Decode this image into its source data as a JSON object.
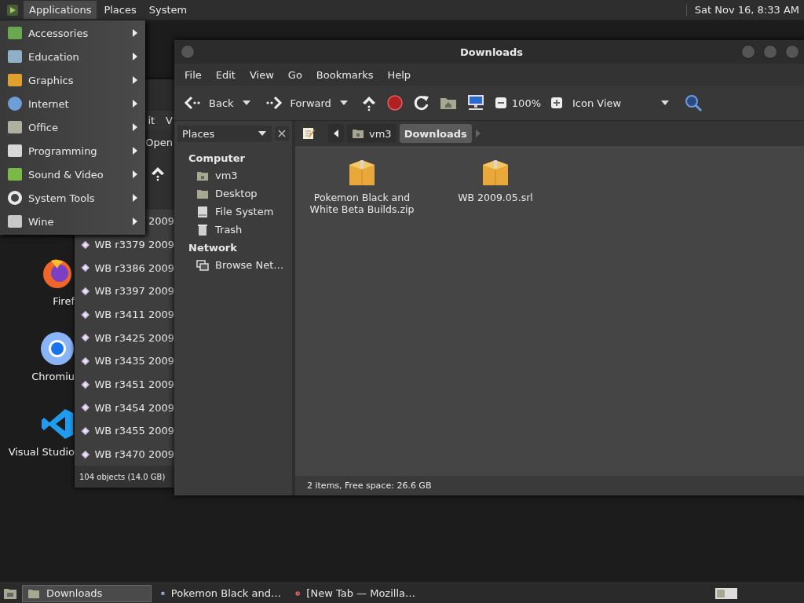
{
  "top_panel": {
    "menus": [
      {
        "label": "Applications",
        "selected": true
      },
      {
        "label": "Places",
        "selected": false
      },
      {
        "label": "System",
        "selected": false
      }
    ],
    "clock": "Sat Nov 16,  8:33 AM"
  },
  "applications_menu": {
    "items": [
      {
        "label": "Accessories",
        "kind": "accessories"
      },
      {
        "label": "Education",
        "kind": "education"
      },
      {
        "label": "Graphics",
        "kind": "graphics"
      },
      {
        "label": "Internet",
        "kind": "internet"
      },
      {
        "label": "Office",
        "kind": "office"
      },
      {
        "label": "Programming",
        "kind": "programming"
      },
      {
        "label": "Sound & Video",
        "kind": "sound-video"
      },
      {
        "label": "System Tools",
        "kind": "system-tools"
      },
      {
        "label": "Wine",
        "kind": "wine"
      }
    ]
  },
  "desktop_icons": [
    {
      "label": "Firef",
      "kind": "firefox"
    },
    {
      "label": "Chromiu",
      "kind": "chromium"
    },
    {
      "label": "Visual Studio",
      "kind": "vscode"
    }
  ],
  "back_window": {
    "menu_fragments": [
      "it",
      "V"
    ],
    "toolbar_fragment": "Open",
    "partial_row": "2009",
    "rows": [
      "WB r3379 2009",
      "WB r3386 2009",
      "WB r3397 2009",
      "WB r3411 2009",
      "WB r3425 2009",
      "WB r3435 2009",
      "WB r3451 2009",
      "WB r3454 2009",
      "WB r3455 2009",
      "WB r3470 2009"
    ],
    "status": "104 objects (14.0 GB)"
  },
  "window": {
    "title": "Downloads",
    "menu": [
      "File",
      "Edit",
      "View",
      "Go",
      "Bookmarks",
      "Help"
    ],
    "toolbar": {
      "back": "Back",
      "forward": "Forward",
      "zoom": "100%",
      "view": "Icon View"
    },
    "sidebar": {
      "selector": "Places",
      "sections": [
        {
          "heading": "Computer",
          "items": [
            {
              "label": "vm3",
              "kind": "home"
            },
            {
              "label": "Desktop",
              "kind": "desktop"
            },
            {
              "label": "File System",
              "kind": "drive"
            },
            {
              "label": "Trash",
              "kind": "trash"
            }
          ]
        },
        {
          "heading": "Network",
          "items": [
            {
              "label": "Browse Net…",
              "kind": "network"
            }
          ]
        }
      ]
    },
    "path": [
      {
        "label": "vm3",
        "selected": false
      },
      {
        "label": "Downloads",
        "selected": true
      }
    ],
    "files": [
      {
        "name": "Pokemon Black and White Beta Builds.zip"
      },
      {
        "name": "WB 2009.05.srl"
      }
    ],
    "status": "2 items, Free space: 26.6 GB"
  },
  "taskbar": {
    "tasks": [
      {
        "label": "Downloads",
        "selected": true,
        "kind": "folder"
      },
      {
        "label": "Pokemon Black and…",
        "selected": false,
        "kind": "archive"
      },
      {
        "label": "[New Tab — Mozilla…",
        "selected": false,
        "kind": "firefox"
      }
    ]
  }
}
